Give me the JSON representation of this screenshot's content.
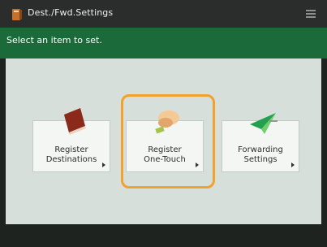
{
  "titlebar": {
    "title": "Dest./Fwd.Settings",
    "icon": "app-icon",
    "menu_icon": "menu-icon"
  },
  "instruction": {
    "text": "Select an item to set."
  },
  "tiles": [
    {
      "line1": "Register",
      "line2": "Destinations",
      "icon": "address-book-icon"
    },
    {
      "line1": "Register",
      "line2": "One-Touch",
      "icon": "one-touch-hand-icon",
      "selected": true
    },
    {
      "line1": "Forwarding",
      "line2": "Settings",
      "icon": "paper-plane-icon"
    }
  ],
  "colors": {
    "header_green": "#1b6a3a",
    "selection": "#f2a12e",
    "content_bg": "#d6dfd9"
  }
}
